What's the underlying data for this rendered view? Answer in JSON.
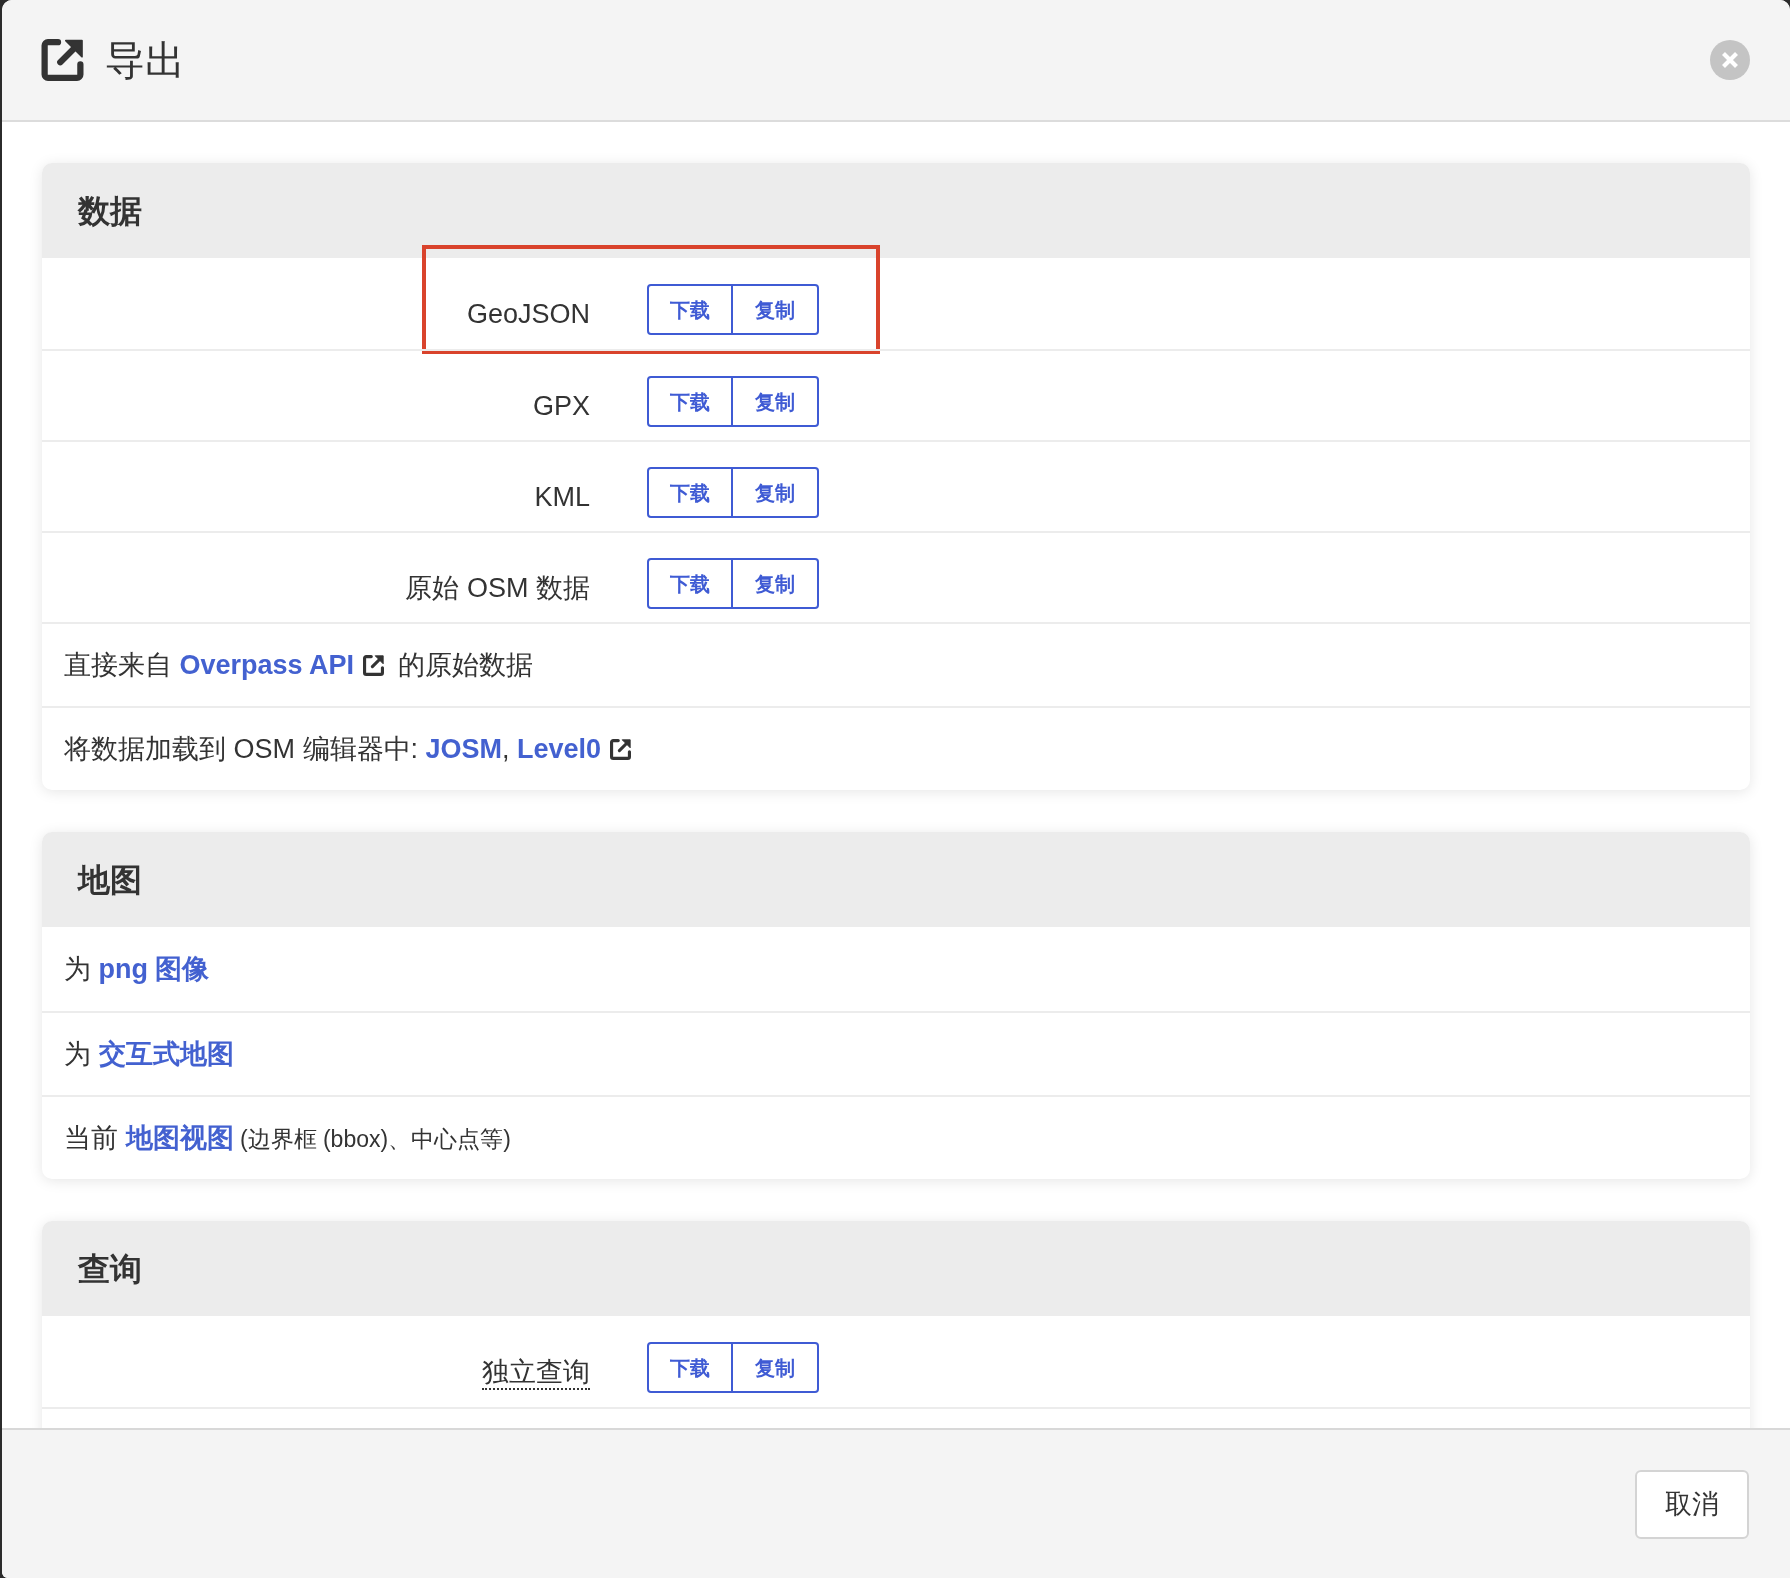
{
  "dialog": {
    "title": "导出"
  },
  "sections": [
    {
      "title": "数据",
      "rows": [
        {
          "kind": "format",
          "label": "GeoJSON",
          "tooltip": false,
          "highlighted": true,
          "buttons": [
            "下载",
            "复制"
          ]
        },
        {
          "kind": "format",
          "label": "GPX",
          "tooltip": false,
          "highlighted": false,
          "buttons": [
            "下载",
            "复制"
          ]
        },
        {
          "kind": "format",
          "label": "KML",
          "tooltip": false,
          "highlighted": false,
          "buttons": [
            "下载",
            "复制"
          ]
        },
        {
          "kind": "format",
          "label": "原始 OSM 数据",
          "tooltip": false,
          "highlighted": false,
          "buttons": [
            "下载",
            "复制"
          ]
        },
        {
          "kind": "text",
          "parts": [
            {
              "kind": "plain",
              "text": "直接来自 "
            },
            {
              "kind": "link",
              "text": "Overpass API",
              "external": true
            },
            {
              "kind": "plain",
              "text": " 的原始数据"
            }
          ]
        },
        {
          "kind": "text",
          "parts": [
            {
              "kind": "plain",
              "text": "将数据加载到 OSM 编辑器中: "
            },
            {
              "kind": "link",
              "text": "JOSM",
              "external": false
            },
            {
              "kind": "plain",
              "text": ", "
            },
            {
              "kind": "link",
              "text": "Level0",
              "external": true
            }
          ]
        }
      ]
    },
    {
      "title": "地图",
      "rows": [
        {
          "kind": "text",
          "parts": [
            {
              "kind": "plain",
              "text": "为 "
            },
            {
              "kind": "link",
              "text": "png 图像",
              "external": false
            }
          ]
        },
        {
          "kind": "text",
          "parts": [
            {
              "kind": "plain",
              "text": "为 "
            },
            {
              "kind": "link",
              "text": "交互式地图",
              "external": false
            }
          ]
        },
        {
          "kind": "text",
          "parts": [
            {
              "kind": "plain",
              "text": "当前 "
            },
            {
              "kind": "link",
              "text": "地图视图",
              "external": false
            },
            {
              "kind": "note",
              "text": " (边界框 (bbox)、中心点等)"
            }
          ]
        }
      ]
    },
    {
      "title": "查询",
      "rows": [
        {
          "kind": "format",
          "label": "独立查询",
          "tooltip": true,
          "highlighted": false,
          "buttons": [
            "下载",
            "复制"
          ]
        }
      ]
    }
  ],
  "footer": {
    "buttons": [
      "取消"
    ]
  }
}
